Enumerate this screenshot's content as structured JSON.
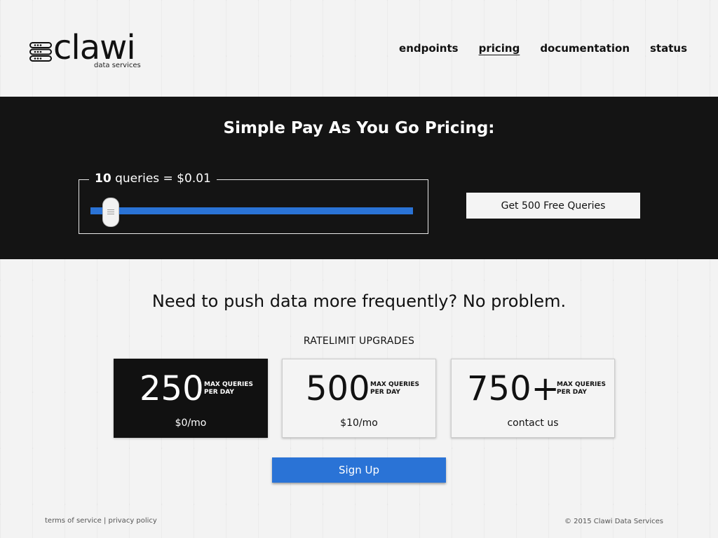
{
  "brand": {
    "name": "clawi",
    "tagline": "data services"
  },
  "nav": [
    {
      "label": "endpoints",
      "active": false
    },
    {
      "label": "pricing",
      "active": true
    },
    {
      "label": "documentation",
      "active": false
    },
    {
      "label": "status",
      "active": false
    }
  ],
  "hero": {
    "title": "Simple Pay As You Go Pricing:",
    "slider": {
      "queries": "10",
      "suffix": "queries = $0.01",
      "position": 0.04
    },
    "free_button": "Get 500 Free Queries"
  },
  "upgrades": {
    "headline": "Need to push data more frequently? No problem.",
    "label": "RATELIMIT UPGRADES",
    "plans": [
      {
        "amount": "250",
        "unit_line1": "MAX QUERIES",
        "unit_line2": "PER DAY",
        "price": "$0/mo",
        "selected": true
      },
      {
        "amount": "500",
        "unit_line1": "MAX QUERIES",
        "unit_line2": "PER DAY",
        "price": "$10/mo",
        "selected": false
      },
      {
        "amount": "750+",
        "unit_line1": "MAX QUERIES",
        "unit_line2": "PER DAY",
        "price": "contact us",
        "selected": false
      }
    ],
    "signup_button": "Sign Up"
  },
  "footer": {
    "terms": "terms of service",
    "separator": "|",
    "privacy": "privacy policy",
    "copyright": "© 2015 Clawi Data Services"
  },
  "colors": {
    "accent": "#2a73d6",
    "dark": "#141414",
    "page_bg": "#f3f3f3"
  },
  "icons": {
    "logo": "server-stack-icon",
    "slider_grip": "grip-lines-icon"
  }
}
